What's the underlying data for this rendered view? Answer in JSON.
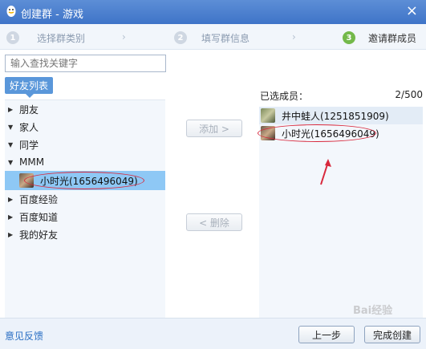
{
  "window": {
    "title": "创建群 - 游戏",
    "close_glyph": "×"
  },
  "steps": [
    {
      "num": "1",
      "label": "选择群类别"
    },
    {
      "num": "2",
      "label": "填写群信息"
    },
    {
      "num": "3",
      "label": "邀请群成员"
    }
  ],
  "search": {
    "placeholder": "输入查找关键字"
  },
  "friend_tab": "好友列表",
  "tree": {
    "groups": [
      {
        "label": "朋友",
        "expanded": false
      },
      {
        "label": "家人",
        "expanded": true
      },
      {
        "label": "同学",
        "expanded": true
      },
      {
        "label": "MMM",
        "expanded": true
      },
      {
        "label": "百度经验",
        "expanded": false
      },
      {
        "label": "百度知道",
        "expanded": false
      },
      {
        "label": "我的好友",
        "expanded": false
      }
    ],
    "selected_member": "小时光(1656496049)"
  },
  "buttons": {
    "add": "添加 >",
    "remove": "< 删除",
    "prev": "上一步",
    "finish": "完成创建"
  },
  "selected": {
    "header": "已选成员：",
    "count": "2/500",
    "members": [
      {
        "name": "井中蛙人(1251851909)"
      },
      {
        "name": "小时光(1656496049)"
      }
    ]
  },
  "footer": {
    "feedback": "意见反馈"
  },
  "colors": {
    "titlebar": "#4a80cf",
    "active_step": "#74b94a",
    "annotation_red": "#d8283c",
    "selection_blue": "#8ec8f5"
  },
  "icons": {
    "app": "qq-penguin-icon",
    "close": "close-icon",
    "collapsed": "triangle-right-icon",
    "expanded": "triangle-down-icon"
  },
  "watermark": "Bai经验"
}
